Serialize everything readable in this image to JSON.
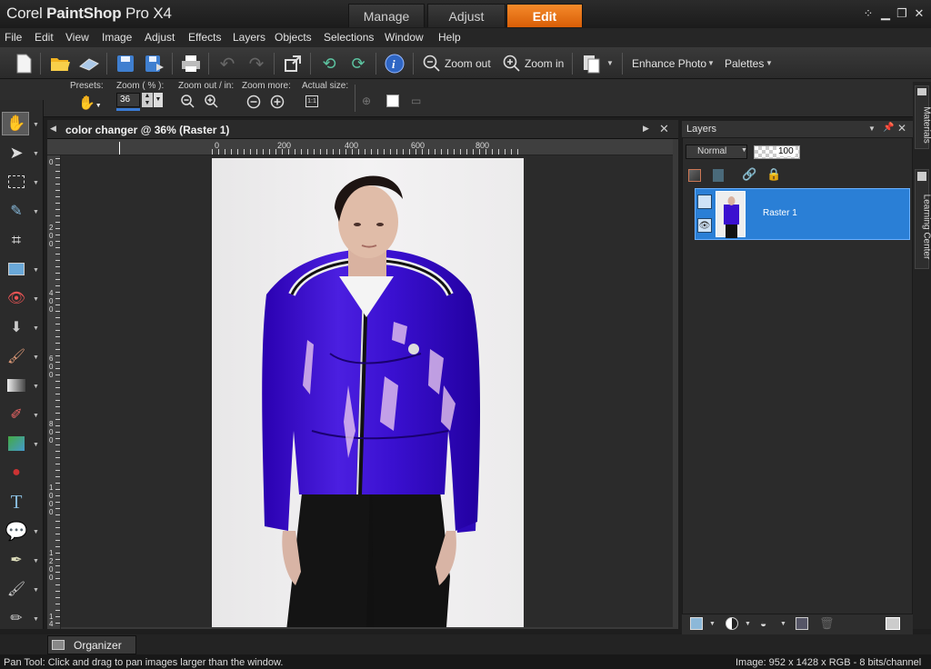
{
  "app": {
    "title_a": "Corel",
    "title_b": "PaintShop",
    "title_c": "Pro X4"
  },
  "workspace_tabs": [
    {
      "label": "Manage"
    },
    {
      "label": "Adjust"
    },
    {
      "label": "Edit"
    }
  ],
  "menu": [
    "File",
    "Edit",
    "View",
    "Image",
    "Adjust",
    "Effects",
    "Layers",
    "Objects",
    "Selections",
    "Window",
    "Help"
  ],
  "toolbar": {
    "zoom_out": "Zoom out",
    "zoom_in": "Zoom in",
    "enhance_photo": "Enhance Photo",
    "palettes": "Palettes"
  },
  "options": {
    "presets": "Presets:",
    "zoom_pct": "Zoom ( % ):",
    "zoom_value": "36",
    "zoom_out_in": "Zoom out / in:",
    "zoom_more": "Zoom more:",
    "actual_size": "Actual size:"
  },
  "document": {
    "title": "color changer @  36% (Raster 1)"
  },
  "ruler": {
    "h": [
      "0",
      "200",
      "400",
      "600",
      "800"
    ],
    "v": [
      "0",
      "2 0 0",
      "4 0 0",
      "6 0 0",
      "8 0 0",
      "1 0 0 0",
      "1 2 0 0",
      "1 4"
    ]
  },
  "layers": {
    "title": "Layers",
    "blend_mode": "Normal",
    "opacity": "100",
    "layer_name": "Raster 1"
  },
  "side_tabs": {
    "materials": "Materials",
    "learning": "Learning Center"
  },
  "organizer": "Organizer",
  "status": {
    "left": "Pan Tool: Click and drag to pan images larger than the window.",
    "right": "Image:  952 x 1428 x RGB - 8 bits/channel"
  }
}
